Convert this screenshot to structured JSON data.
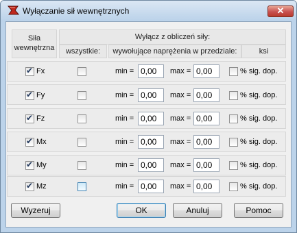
{
  "window": {
    "title": "Wyłączanie sił wewnętrznych",
    "close_label": "✕"
  },
  "header": {
    "col_force_line1": "Siła",
    "col_force_line2": "wewnętrzna",
    "group_label": "Wyłącz z obliczeń siły:",
    "col_all": "wszystkie:",
    "col_range": "wywołujące naprężenia w przedziale:",
    "col_unit": "ksi"
  },
  "labels": {
    "min": "min =",
    "max": "max =",
    "pct": "% sig. dop."
  },
  "rows": [
    {
      "name": "Fx",
      "enabled": true,
      "all": false,
      "min": "0,00",
      "max": "0,00",
      "pct": false
    },
    {
      "name": "Fy",
      "enabled": true,
      "all": false,
      "min": "0,00",
      "max": "0,00",
      "pct": false
    },
    {
      "name": "Fz",
      "enabled": true,
      "all": false,
      "min": "0,00",
      "max": "0,00",
      "pct": false
    },
    {
      "name": "Mx",
      "enabled": true,
      "all": false,
      "min": "0,00",
      "max": "0,00",
      "pct": false
    },
    {
      "name": "My",
      "enabled": true,
      "all": false,
      "min": "0,00",
      "max": "0,00",
      "pct": false
    },
    {
      "name": "Mz",
      "enabled": true,
      "all": false,
      "min": "0,00",
      "max": "0,00",
      "pct": false
    }
  ],
  "buttons": {
    "reset": "Wyzeruj",
    "ok": "OK",
    "cancel": "Anuluj",
    "help": "Pomoc"
  }
}
